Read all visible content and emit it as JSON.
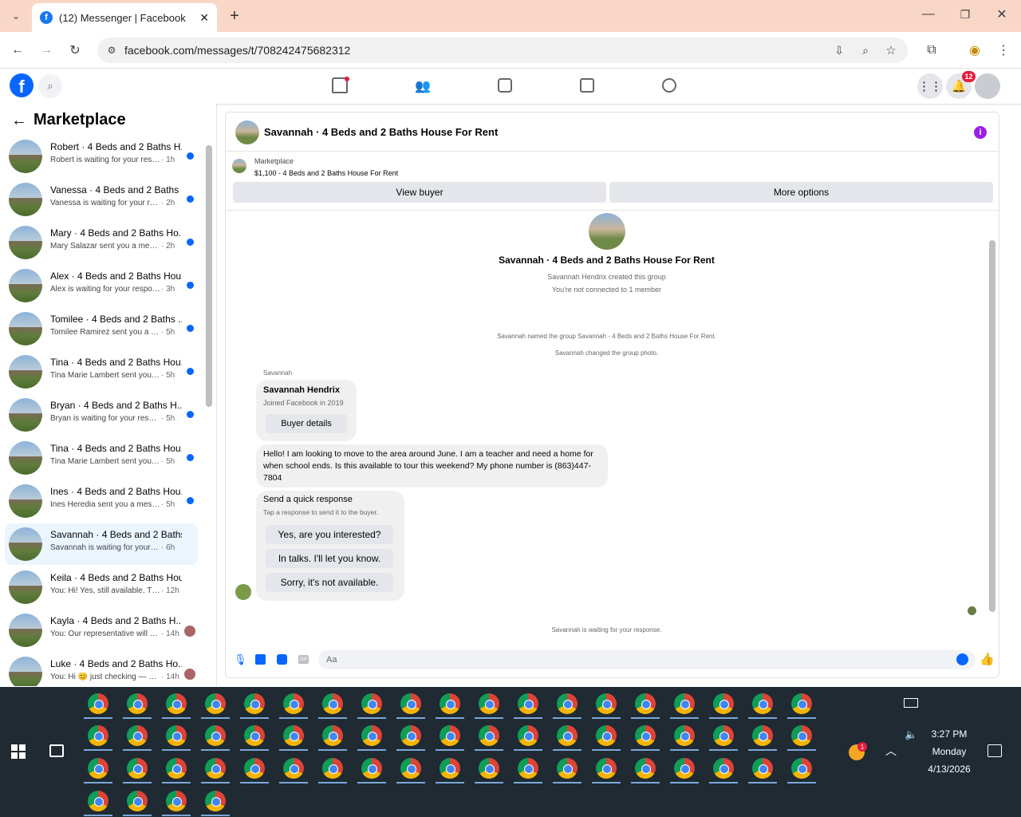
{
  "browser": {
    "tab_title": "(12) Messenger | Facebook",
    "url": "facebook.com/messages/t/708242475682312"
  },
  "fb": {
    "notif_count": "12"
  },
  "sidebar": {
    "title": "Marketplace",
    "conversations": [
      {
        "name": "Robert · 4 Beds and 2 Baths H...",
        "preview": "Robert is waiting for your resp...",
        "time": "· 1h",
        "unread": true
      },
      {
        "name": "Vanessa · 4 Beds and 2 Baths ...",
        "preview": "Vanessa is waiting for your res...",
        "time": "· 2h",
        "unread": true
      },
      {
        "name": "Mary · 4 Beds and 2 Baths Ho...",
        "preview": "Mary Salazar sent you a messa...",
        "time": "· 2h",
        "unread": true
      },
      {
        "name": "Alex · 4 Beds and 2 Baths Hou...",
        "preview": "Alex is waiting for your respon...",
        "time": "· 3h",
        "unread": true
      },
      {
        "name": "Tomilee · 4 Beds and 2 Baths ...",
        "preview": "Tomilee Ramirez sent you a me...",
        "time": "· 5h",
        "unread": true
      },
      {
        "name": "Tina · 4 Beds and 2 Baths Hou...",
        "preview": "Tina Marie Lambert sent you a ...",
        "time": "· 5h",
        "unread": true
      },
      {
        "name": "Bryan · 4 Beds and 2 Baths H...",
        "preview": "Bryan is waiting for your respo...",
        "time": "· 5h",
        "unread": true
      },
      {
        "name": "Tina · 4 Beds and 2 Baths Hou...",
        "preview": "Tina Marie Lambert sent you a ...",
        "time": "· 5h",
        "unread": true
      },
      {
        "name": "Ines · 4 Beds and 2 Baths Hou...",
        "preview": "Ines Heredia sent you a messag...",
        "time": "· 5h",
        "unread": true
      },
      {
        "name": "Savannah · 4 Beds and 2 Baths ...",
        "preview": "Savannah is waiting for your respo...",
        "time": "· 6h",
        "unread": false
      },
      {
        "name": "Keila · 4 Beds and 2 Baths Hous...",
        "preview": "You: Hi! Yes, still available. This o...",
        "time": "· 12h",
        "unread": false
      },
      {
        "name": "Kayla · 4 Beds and 2 Baths H...",
        "preview": "You: Our representative will co...",
        "time": "· 14h",
        "unread": false
      },
      {
        "name": "Luke · 4 Beds and 2 Baths Ho...",
        "preview": "You: Hi 😊 just checking — ar...",
        "time": "· 14h",
        "unread": false
      }
    ]
  },
  "chat": {
    "header_title": "Savannah · 4 Beds and 2 Baths House For Rent",
    "listing_source": "Marketplace",
    "listing_line": "$1,100 - 4 Beds and 2 Baths House For Rent",
    "view_buyer": "View buyer",
    "more_options": "More options",
    "group_title": "Savannah · 4 Beds and 2 Baths House For Rent",
    "created_by": "Savannah Hendrix created this group",
    "not_connected": "You're not connected to 1 member",
    "sys_named": "Savannah named the group Savannah · 4 Beds and 2 Baths House For Rent.",
    "sys_photo": "Savannah changed the group photo.",
    "sender": "Savannah",
    "buyer_name": "Savannah Hendrix",
    "buyer_joined": "Joined Facebook in 2019",
    "buyer_details": "Buyer details",
    "message": "Hello! I am looking to move to the area around June. I am a teacher and need a home for when school ends. Is this available to tour this weekend? My phone number is (863)447-7804",
    "quick_title": "Send a quick response",
    "quick_sub": "Tap a response to send it to the buyer.",
    "quick_1": "Yes, are you interested?",
    "quick_2": "In talks. I'll let you know.",
    "quick_3": "Sorry, it's not available.",
    "waiting": "Savannah is waiting for your response.",
    "composer_placeholder": "Aa"
  },
  "taskbar": {
    "time": "3:27 PM",
    "day": "Monday",
    "date": "4/13/2026",
    "weather_badge": "1"
  },
  "colors": {
    "fb_blue": "#0866ff",
    "tab_bg": "#f9d7c7",
    "taskbar": "#1f2a33"
  }
}
